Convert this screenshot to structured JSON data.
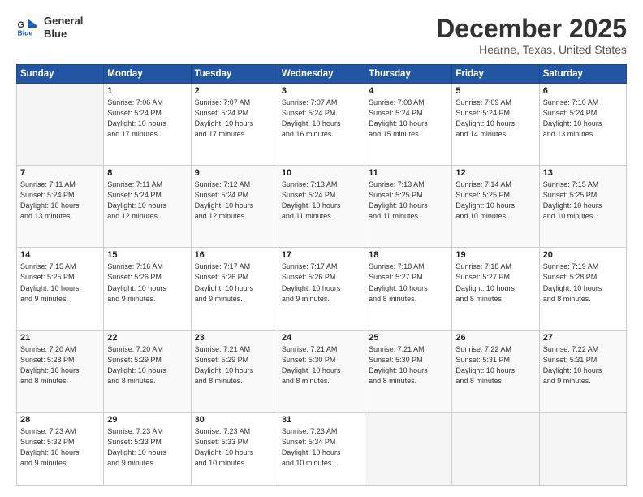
{
  "header": {
    "logo": {
      "line1": "General",
      "line2": "Blue"
    },
    "title": "December 2025",
    "location": "Hearne, Texas, United States"
  },
  "weekdays": [
    "Sunday",
    "Monday",
    "Tuesday",
    "Wednesday",
    "Thursday",
    "Friday",
    "Saturday"
  ],
  "weeks": [
    [
      {
        "day": "",
        "info": ""
      },
      {
        "day": "1",
        "info": "Sunrise: 7:06 AM\nSunset: 5:24 PM\nDaylight: 10 hours\nand 17 minutes."
      },
      {
        "day": "2",
        "info": "Sunrise: 7:07 AM\nSunset: 5:24 PM\nDaylight: 10 hours\nand 17 minutes."
      },
      {
        "day": "3",
        "info": "Sunrise: 7:07 AM\nSunset: 5:24 PM\nDaylight: 10 hours\nand 16 minutes."
      },
      {
        "day": "4",
        "info": "Sunrise: 7:08 AM\nSunset: 5:24 PM\nDaylight: 10 hours\nand 15 minutes."
      },
      {
        "day": "5",
        "info": "Sunrise: 7:09 AM\nSunset: 5:24 PM\nDaylight: 10 hours\nand 14 minutes."
      },
      {
        "day": "6",
        "info": "Sunrise: 7:10 AM\nSunset: 5:24 PM\nDaylight: 10 hours\nand 13 minutes."
      }
    ],
    [
      {
        "day": "7",
        "info": "Sunrise: 7:11 AM\nSunset: 5:24 PM\nDaylight: 10 hours\nand 13 minutes."
      },
      {
        "day": "8",
        "info": "Sunrise: 7:11 AM\nSunset: 5:24 PM\nDaylight: 10 hours\nand 12 minutes."
      },
      {
        "day": "9",
        "info": "Sunrise: 7:12 AM\nSunset: 5:24 PM\nDaylight: 10 hours\nand 12 minutes."
      },
      {
        "day": "10",
        "info": "Sunrise: 7:13 AM\nSunset: 5:24 PM\nDaylight: 10 hours\nand 11 minutes."
      },
      {
        "day": "11",
        "info": "Sunrise: 7:13 AM\nSunset: 5:25 PM\nDaylight: 10 hours\nand 11 minutes."
      },
      {
        "day": "12",
        "info": "Sunrise: 7:14 AM\nSunset: 5:25 PM\nDaylight: 10 hours\nand 10 minutes."
      },
      {
        "day": "13",
        "info": "Sunrise: 7:15 AM\nSunset: 5:25 PM\nDaylight: 10 hours\nand 10 minutes."
      }
    ],
    [
      {
        "day": "14",
        "info": "Sunrise: 7:15 AM\nSunset: 5:25 PM\nDaylight: 10 hours\nand 9 minutes."
      },
      {
        "day": "15",
        "info": "Sunrise: 7:16 AM\nSunset: 5:26 PM\nDaylight: 10 hours\nand 9 minutes."
      },
      {
        "day": "16",
        "info": "Sunrise: 7:17 AM\nSunset: 5:26 PM\nDaylight: 10 hours\nand 9 minutes."
      },
      {
        "day": "17",
        "info": "Sunrise: 7:17 AM\nSunset: 5:26 PM\nDaylight: 10 hours\nand 9 minutes."
      },
      {
        "day": "18",
        "info": "Sunrise: 7:18 AM\nSunset: 5:27 PM\nDaylight: 10 hours\nand 8 minutes."
      },
      {
        "day": "19",
        "info": "Sunrise: 7:18 AM\nSunset: 5:27 PM\nDaylight: 10 hours\nand 8 minutes."
      },
      {
        "day": "20",
        "info": "Sunrise: 7:19 AM\nSunset: 5:28 PM\nDaylight: 10 hours\nand 8 minutes."
      }
    ],
    [
      {
        "day": "21",
        "info": "Sunrise: 7:20 AM\nSunset: 5:28 PM\nDaylight: 10 hours\nand 8 minutes."
      },
      {
        "day": "22",
        "info": "Sunrise: 7:20 AM\nSunset: 5:29 PM\nDaylight: 10 hours\nand 8 minutes."
      },
      {
        "day": "23",
        "info": "Sunrise: 7:21 AM\nSunset: 5:29 PM\nDaylight: 10 hours\nand 8 minutes."
      },
      {
        "day": "24",
        "info": "Sunrise: 7:21 AM\nSunset: 5:30 PM\nDaylight: 10 hours\nand 8 minutes."
      },
      {
        "day": "25",
        "info": "Sunrise: 7:21 AM\nSunset: 5:30 PM\nDaylight: 10 hours\nand 8 minutes."
      },
      {
        "day": "26",
        "info": "Sunrise: 7:22 AM\nSunset: 5:31 PM\nDaylight: 10 hours\nand 8 minutes."
      },
      {
        "day": "27",
        "info": "Sunrise: 7:22 AM\nSunset: 5:31 PM\nDaylight: 10 hours\nand 9 minutes."
      }
    ],
    [
      {
        "day": "28",
        "info": "Sunrise: 7:23 AM\nSunset: 5:32 PM\nDaylight: 10 hours\nand 9 minutes."
      },
      {
        "day": "29",
        "info": "Sunrise: 7:23 AM\nSunset: 5:33 PM\nDaylight: 10 hours\nand 9 minutes."
      },
      {
        "day": "30",
        "info": "Sunrise: 7:23 AM\nSunset: 5:33 PM\nDaylight: 10 hours\nand 10 minutes."
      },
      {
        "day": "31",
        "info": "Sunrise: 7:23 AM\nSunset: 5:34 PM\nDaylight: 10 hours\nand 10 minutes."
      },
      {
        "day": "",
        "info": ""
      },
      {
        "day": "",
        "info": ""
      },
      {
        "day": "",
        "info": ""
      }
    ]
  ]
}
